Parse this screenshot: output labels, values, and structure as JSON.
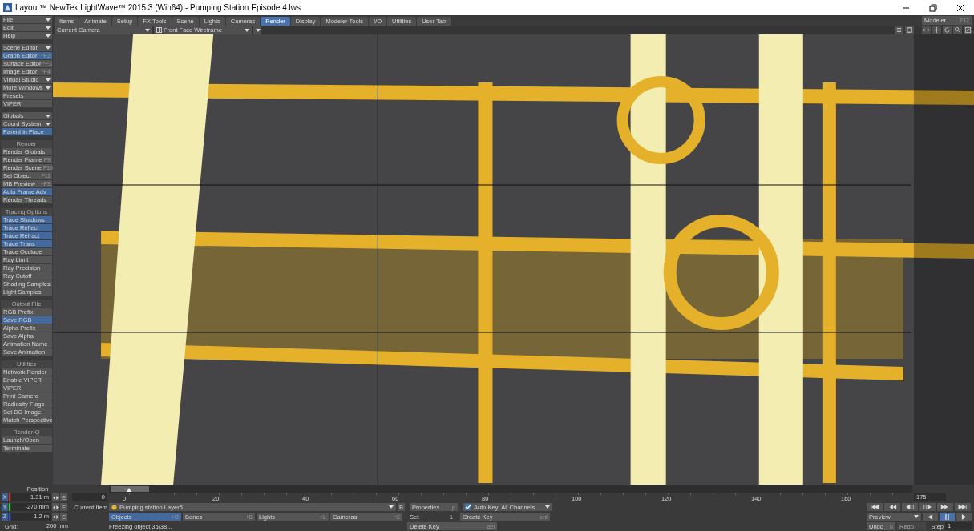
{
  "window": {
    "title": "Layout™ NewTek LightWave™ 2015.3 (Win64) - Pumping Station Episode 4.lws"
  },
  "tabs": [
    {
      "label": "Items",
      "selected": false
    },
    {
      "label": "Animate",
      "selected": false
    },
    {
      "label": "Setup",
      "selected": false
    },
    {
      "label": "FX Tools",
      "selected": false
    },
    {
      "label": "Scene",
      "selected": false
    },
    {
      "label": "Lights",
      "selected": false
    },
    {
      "label": "Cameras",
      "selected": false
    },
    {
      "label": "Render",
      "selected": true
    },
    {
      "label": "Display",
      "selected": false
    },
    {
      "label": "Modeler Tools",
      "selected": false
    },
    {
      "label": "I/O",
      "selected": false
    },
    {
      "label": "Utilities",
      "selected": false
    },
    {
      "label": "User Tab",
      "selected": false
    }
  ],
  "modeler_button": {
    "label": "Modeler",
    "shortcut": "F12"
  },
  "sidebar": {
    "groups": [
      {
        "items": [
          {
            "label": "File",
            "kind": "dropdown",
            "on": false
          },
          {
            "label": "Edit",
            "kind": "dropdown",
            "on": false
          },
          {
            "label": "Help",
            "kind": "dropdown",
            "on": false
          }
        ]
      },
      {
        "items": [
          {
            "label": "Scene Editor",
            "kind": "dropdown",
            "on": false
          },
          {
            "label": "Graph Editor",
            "shortcut": "^F2",
            "kind": "button",
            "on": true
          },
          {
            "label": "Surface Editor",
            "shortcut": "^F3",
            "kind": "button",
            "on": false
          },
          {
            "label": "Image Editor",
            "shortcut": "^F4",
            "kind": "button",
            "on": false
          },
          {
            "label": "Virtual Studio",
            "kind": "dropdown",
            "on": false
          },
          {
            "label": "More Windows",
            "kind": "dropdown",
            "on": false
          },
          {
            "label": "Presets",
            "kind": "button",
            "on": false
          },
          {
            "label": "VIPER",
            "kind": "button",
            "on": false
          }
        ]
      },
      {
        "items": [
          {
            "label": "Globals",
            "kind": "dropdown",
            "on": false
          },
          {
            "label": "Coord System",
            "kind": "dropdown",
            "on": false
          },
          {
            "label": "Parent in Place",
            "kind": "button",
            "on": true
          }
        ]
      },
      {
        "title": "Render",
        "items": [
          {
            "label": "Render Globals",
            "kind": "button",
            "on": false
          },
          {
            "label": "Render Frame",
            "shortcut": "F9",
            "kind": "button",
            "on": false
          },
          {
            "label": "Render Scene",
            "shortcut": "F10",
            "kind": "button",
            "on": false
          },
          {
            "label": "Sel Object",
            "shortcut": "F11",
            "kind": "button",
            "on": false
          },
          {
            "label": "MB Preview",
            "shortcut": "+F9",
            "kind": "button",
            "on": false
          },
          {
            "label": "Auto Frame Adv",
            "kind": "button",
            "on": true
          },
          {
            "label": "Render Threads",
            "kind": "button",
            "on": false
          }
        ]
      },
      {
        "title": "Tracing Options",
        "items": [
          {
            "label": "Trace Shadows",
            "kind": "button",
            "on": true
          },
          {
            "label": "Trace Reflect",
            "kind": "button",
            "on": true
          },
          {
            "label": "Trace Refract",
            "kind": "button",
            "on": true
          },
          {
            "label": "Trace Trans",
            "kind": "button",
            "on": true
          },
          {
            "label": "Trace Occlude",
            "kind": "button",
            "on": false
          },
          {
            "label": "Ray Limit",
            "kind": "button",
            "on": false
          },
          {
            "label": "Ray Precision",
            "kind": "button",
            "on": false
          },
          {
            "label": "Ray Cutoff",
            "kind": "button",
            "on": false
          },
          {
            "label": "Shading Samples",
            "kind": "button",
            "on": false
          },
          {
            "label": "Light Samples",
            "kind": "button",
            "on": false
          }
        ]
      },
      {
        "title": "Output File",
        "items": [
          {
            "label": "RGB Prefix",
            "kind": "button",
            "on": false
          },
          {
            "label": "Save RGB",
            "kind": "button",
            "on": true
          },
          {
            "label": "Alpha Prefix",
            "kind": "button",
            "on": false
          },
          {
            "label": "Save Alpha",
            "kind": "button",
            "on": false
          },
          {
            "label": "Animation Name",
            "kind": "button",
            "on": false
          },
          {
            "label": "Save Animation",
            "kind": "button",
            "on": false
          }
        ]
      },
      {
        "title": "Utilities",
        "items": [
          {
            "label": "Network Render",
            "kind": "button",
            "on": false
          },
          {
            "label": "Enable VIPER",
            "kind": "button",
            "on": false
          },
          {
            "label": "VIPER",
            "kind": "button",
            "on": false
          },
          {
            "label": "Print Camera",
            "kind": "button",
            "on": false
          },
          {
            "label": "Radiosity Flags",
            "kind": "button",
            "on": false
          },
          {
            "label": "Set BG Image",
            "kind": "button",
            "on": false
          },
          {
            "label": "Match Perspective",
            "kind": "button",
            "on": false
          }
        ]
      },
      {
        "title": "Render-Q",
        "items": [
          {
            "label": "Launch/Open",
            "kind": "button",
            "on": false
          },
          {
            "label": "Terminate",
            "kind": "button",
            "on": false
          }
        ]
      }
    ]
  },
  "viewport_header": {
    "camera": "Current Camera",
    "shading": "Front Face Wireframe"
  },
  "position": {
    "label": "Position",
    "axes": [
      {
        "axis": "X",
        "value": "1.31 m",
        "envelope": "E",
        "color": "#c83232"
      },
      {
        "axis": "Y",
        "value": "-270 mm",
        "envelope": "E",
        "color": "#32c832"
      },
      {
        "axis": "Z",
        "value": "-1.2 m",
        "envelope": "E",
        "color": "#3250d2"
      }
    ],
    "grid_label": "Grid:",
    "grid_value": "200 mm"
  },
  "timeline": {
    "start": "0",
    "end": "175",
    "ticks": [
      "0",
      "20",
      "40",
      "60",
      "80",
      "100",
      "120",
      "140",
      "160"
    ]
  },
  "current_item": {
    "label": "Current Item",
    "value": "Pumping station Layer5",
    "b_button": "B"
  },
  "properties": {
    "label": "Properties",
    "shortcut": "p"
  },
  "auto_key": {
    "label": "Auto Key: All Channels",
    "checked": true
  },
  "item_types": [
    {
      "label": "Objects",
      "shortcut": "+O",
      "selected": true
    },
    {
      "label": "Bones",
      "shortcut": "+B",
      "selected": false
    },
    {
      "label": "Lights",
      "shortcut": "+L",
      "selected": false
    },
    {
      "label": "Cameras",
      "shortcut": "+C",
      "selected": false
    }
  ],
  "sel": {
    "label": "Sel:",
    "value": "1"
  },
  "keys": [
    {
      "label": "Create Key",
      "shortcut": "ent"
    },
    {
      "label": "Delete Key",
      "shortcut": "del"
    }
  ],
  "status": "Freezing object 35/38...",
  "preview": "Preview",
  "playback": [
    {
      "kind": "reverse",
      "selected": false
    },
    {
      "kind": "pause",
      "selected": true
    },
    {
      "kind": "play",
      "selected": false
    }
  ],
  "undo": {
    "label": "Undo",
    "shortcut": "u"
  },
  "redo": {
    "label": "Redo",
    "disabled": true
  },
  "step": {
    "label": "Step",
    "value": "1"
  }
}
